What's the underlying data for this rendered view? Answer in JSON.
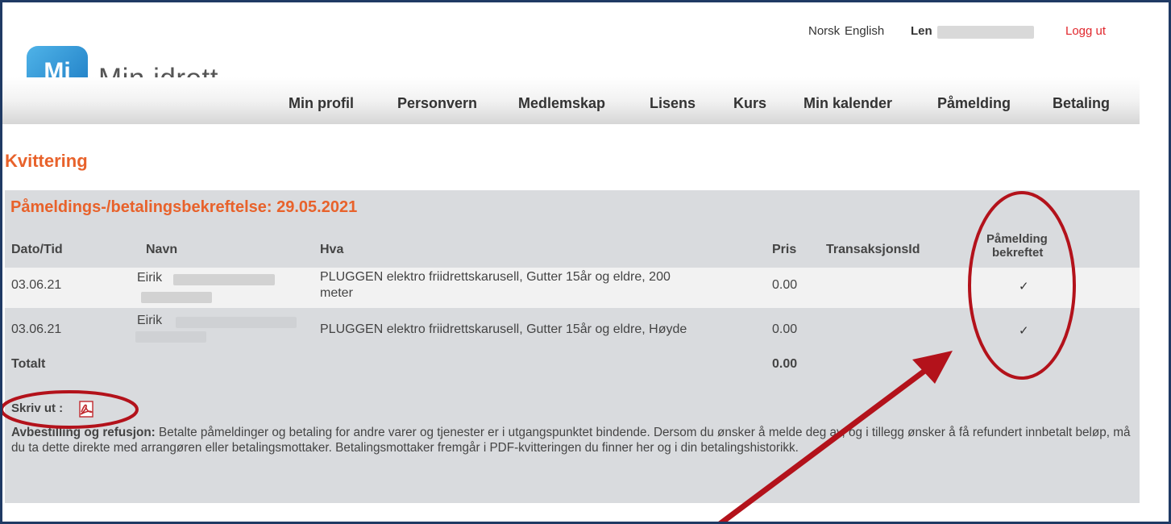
{
  "header": {
    "lang_norsk": "Norsk",
    "lang_english": "English",
    "user_name": "Len",
    "logout": "Logg ut"
  },
  "logo": {
    "badge": "Mi",
    "text": "Min idrett"
  },
  "nav": {
    "items": [
      "Min profil",
      "Personvern",
      "Medlemskap",
      "Lisens",
      "Kurs",
      "Min kalender",
      "Påmelding",
      "Betaling"
    ]
  },
  "page": {
    "title": "Kvittering"
  },
  "receipt": {
    "title": "Påmeldings-/betalingsbekreftelse: 29.05.2021",
    "columns": {
      "date": "Dato/Tid",
      "name": "Navn",
      "what": "Hva",
      "price": "Pris",
      "transaction": "TransaksjonsId",
      "confirmed_line1": "Påmelding",
      "confirmed_line2": "bekreftet"
    },
    "rows": [
      {
        "date": "03.06.21",
        "name": "Eirik",
        "what_line1": "PLUGGEN elektro friidrettskarusell, Gutter 15år og eldre, 200",
        "what_line2": "meter",
        "price": "0.00",
        "transaction": "",
        "confirmed": "✓"
      },
      {
        "date": "03.06.21",
        "name": "Eirik",
        "what_line1": "PLUGGEN elektro friidrettskarusell, Gutter 15år og eldre, Høyde",
        "what_line2": "",
        "price": "0.00",
        "transaction": "",
        "confirmed": "✓"
      }
    ],
    "total_label": "Totalt",
    "total_value": "0.00",
    "print_label": "Skriv ut :",
    "note_label": "Avbestilling og refusjon:",
    "note_text": " Betalte påmeldinger og betaling for andre varer og tjenester er i utgangspunktet bindende. Dersom du ønsker å melde deg av, og i tillegg ønsker å få refundert innbetalt beløp, må du ta dette direkte med arrangøren eller betalingsmottaker. Betalingsmottaker fremgår i PDF-kvitteringen du finner her og i din betalingshistorikk."
  },
  "colors": {
    "accent_orange": "#e8622b",
    "logout_red": "#e1272d",
    "panel_gray": "#d9dbde",
    "annotation_red": "#b3121b",
    "frame_blue": "#1f3a64"
  }
}
